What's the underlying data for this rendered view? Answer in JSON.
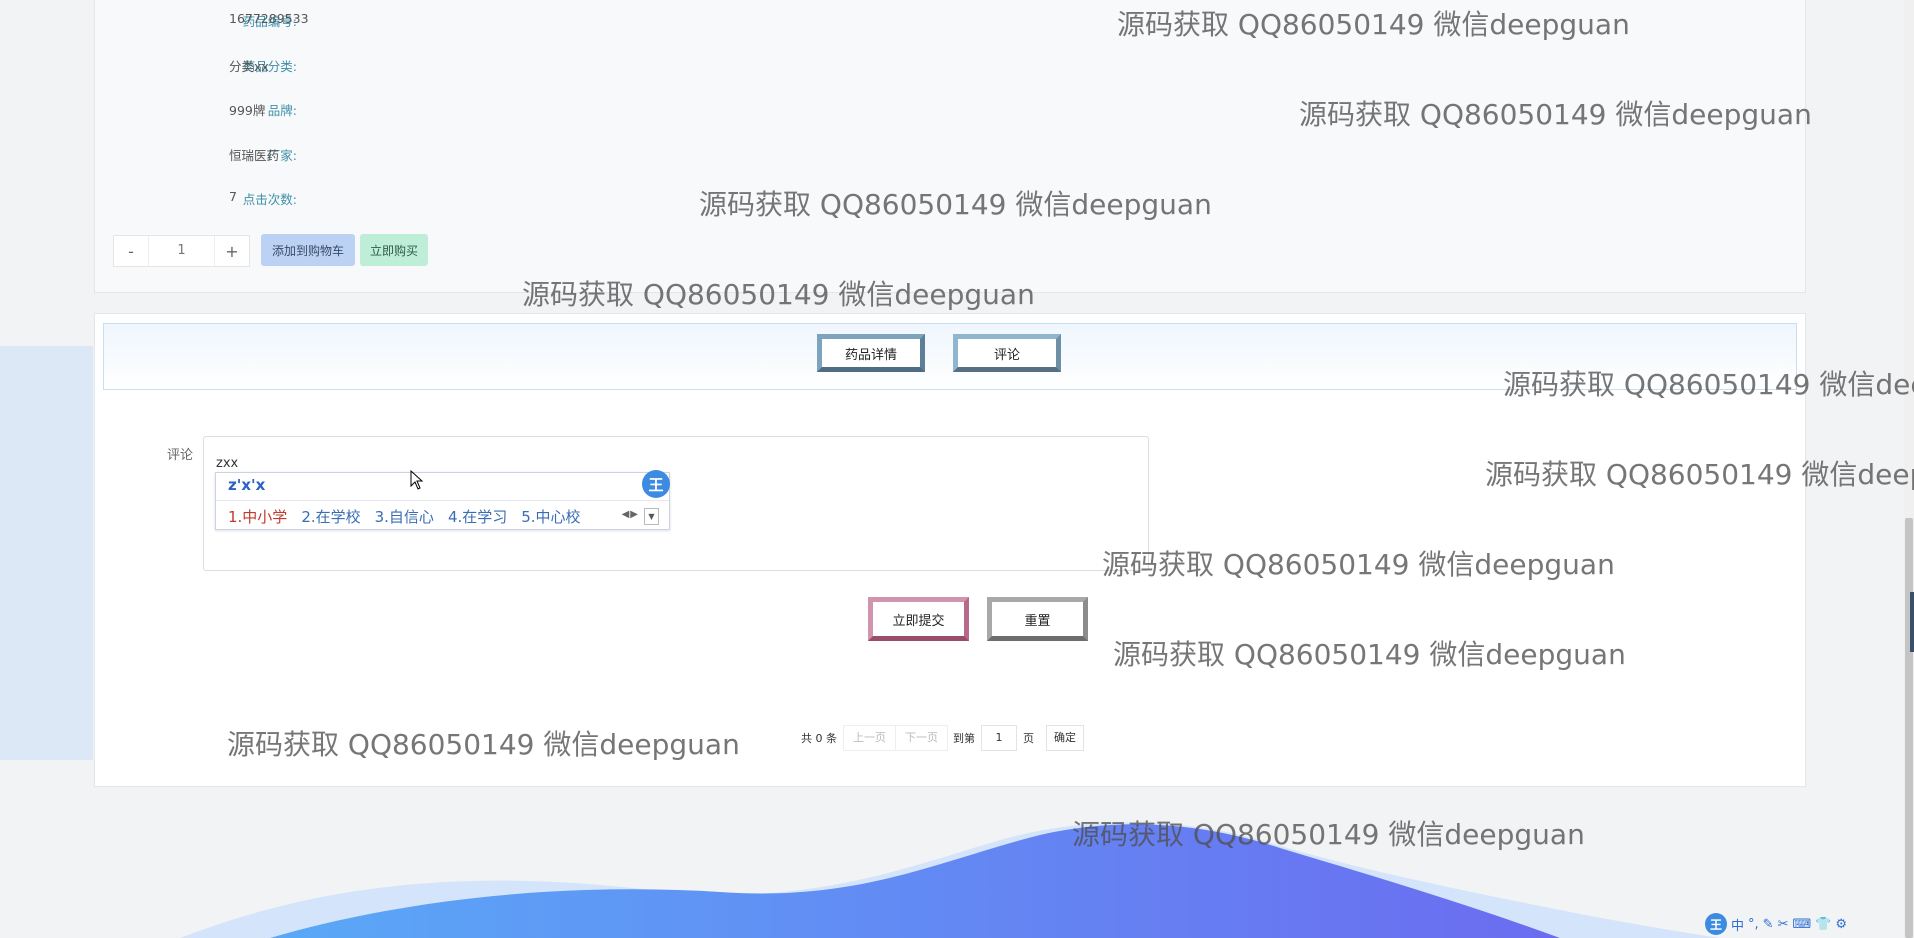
{
  "product_info": {
    "rows": [
      {
        "label": "药品编号:",
        "value": "1677289533"
      },
      {
        "label": "药品分类:",
        "value": "分类xx"
      },
      {
        "label": "品牌:",
        "value": "999牌"
      },
      {
        "label": "厂家:",
        "value": "恒瑞医药"
      },
      {
        "label": "点击次数:",
        "value": "7"
      }
    ],
    "quantity": {
      "minus": "-",
      "value": "1",
      "plus": "+"
    },
    "add_to_cart_label": "添加到购物车",
    "buy_now_label": "立即购买"
  },
  "tabs": [
    {
      "label": "药品详情"
    },
    {
      "label": "评论"
    }
  ],
  "comment_form": {
    "label": "评论",
    "value": "zxx",
    "submit_label": "立即提交",
    "reset_label": "重置"
  },
  "ime_popup": {
    "composition": "z'x'x",
    "logo": "王",
    "candidates": [
      "1.中小学",
      "2.在学校",
      "3.自信心",
      "4.在学习",
      "5.中心校"
    ]
  },
  "pagination": {
    "total_text": "共 0 条",
    "prev_label": "上一页",
    "next_label": "下一页",
    "goto_label": "到第",
    "page_value": "1",
    "page_unit": "页",
    "confirm_label": "确定"
  },
  "watermark_text": "源码获取 QQ86050149 微信deepguan",
  "ime_toolbar": {
    "logo": "王",
    "items": [
      "中",
      "°,",
      "✎",
      "✂",
      "⌨",
      "👕",
      "⚙"
    ]
  }
}
